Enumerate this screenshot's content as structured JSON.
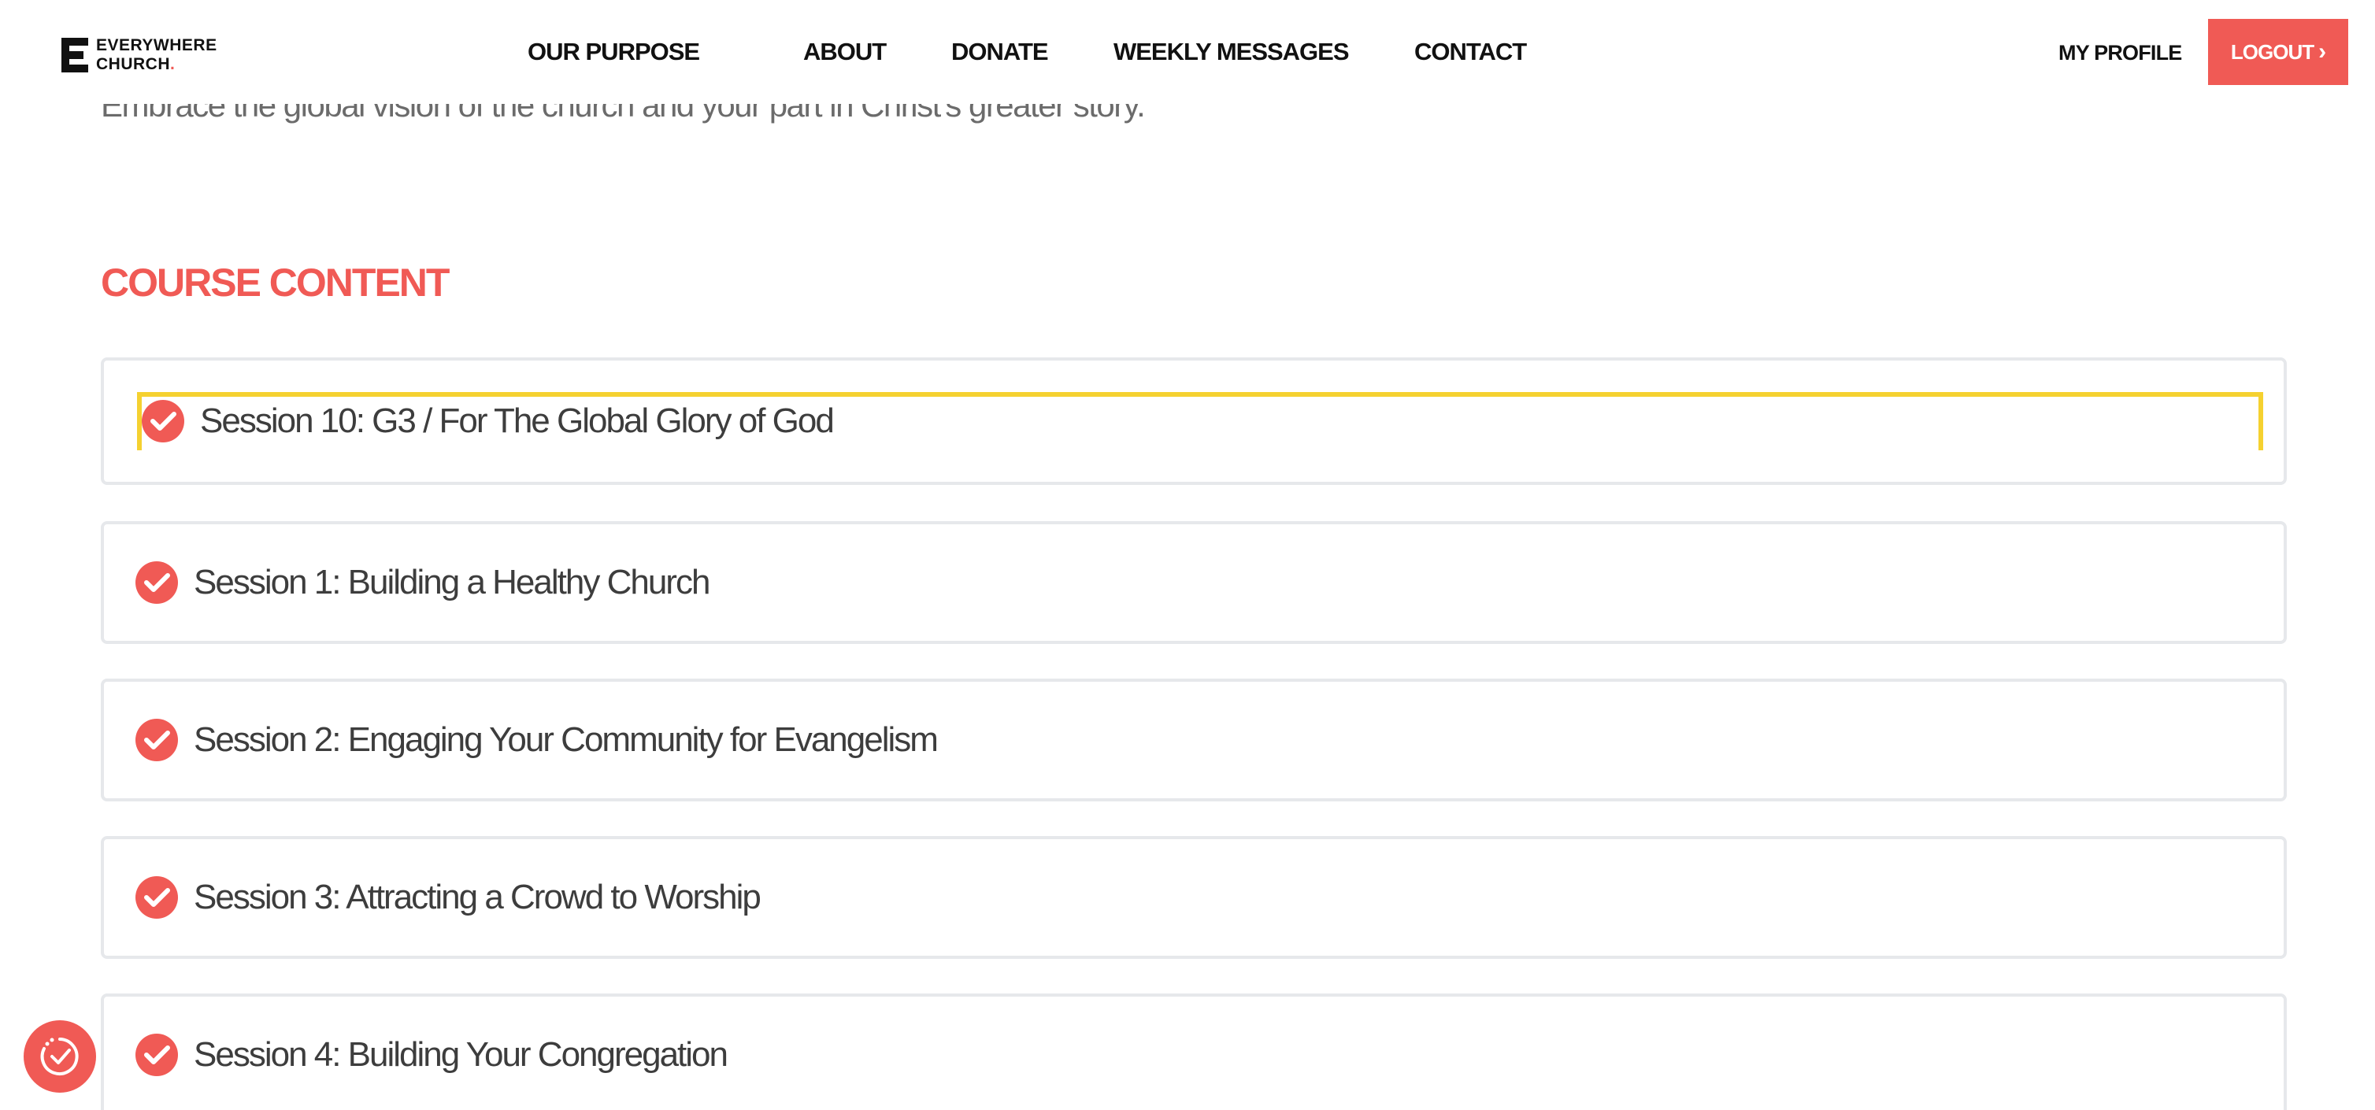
{
  "brand": {
    "line1": "EVERYWHERE",
    "line2": "CHURCH",
    "dot": ".",
    "accent_color": "#f05a55"
  },
  "nav": {
    "items": [
      "OUR PURPOSE",
      "ABOUT",
      "DONATE",
      "WEEKLY MESSAGES",
      "CONTACT"
    ]
  },
  "account": {
    "profile_label": "MY PROFILE",
    "logout_label": "LOGOUT",
    "logout_icon": "chevron-right-icon"
  },
  "intro": {
    "text": "Embrace the global vision of the church and your part in Christ's greater story."
  },
  "course": {
    "heading": "COURSE CONTENT",
    "sessions": [
      {
        "title": "Session 10: G3 / For The Global Glory of God",
        "completed": true,
        "highlighted": true
      },
      {
        "title": "Session 1: Building a Healthy Church",
        "completed": true
      },
      {
        "title": "Session 2: Engaging Your Community for Evangelism",
        "completed": true
      },
      {
        "title": "Session 3: Attracting a Crowd to Worship",
        "completed": true
      },
      {
        "title": "Session 4: Building Your Congregation",
        "completed": true
      }
    ],
    "check_icon": "check-circle-icon",
    "highlight_color": "#f5d130"
  },
  "widget": {
    "icon": "clock-check-icon"
  }
}
